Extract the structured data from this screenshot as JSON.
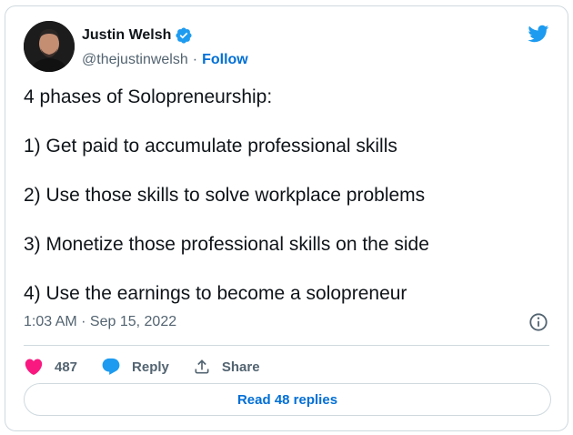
{
  "author": {
    "display_name": "Justin Welsh",
    "handle": "@thejustinwelsh",
    "separator": "·",
    "follow_label": "Follow"
  },
  "tweet": {
    "lines": [
      "4 phases of Solopreneurship:",
      "1) Get paid to accumulate professional skills",
      "2) Use those skills to solve workplace problems",
      "3) Monetize those professional skills on the side",
      "4) Use the earnings to become a solopreneur"
    ],
    "timestamp": "1:03 AM · Sep 15, 2022"
  },
  "actions": {
    "likes_count": "487",
    "reply_label": "Reply",
    "share_label": "Share"
  },
  "footer": {
    "read_replies_label": "Read 48 replies"
  },
  "icons": {
    "verified": "verified-badge-icon",
    "brand": "twitter-bird-icon",
    "info": "info-icon",
    "like": "heart-icon",
    "reply": "speech-bubble-icon",
    "share": "share-upload-icon"
  },
  "colors": {
    "brand_blue": "#1d9bf0",
    "link_blue": "#006fd6",
    "like_pink": "#f91880",
    "muted_text": "#536471",
    "border": "#cfd9de"
  }
}
